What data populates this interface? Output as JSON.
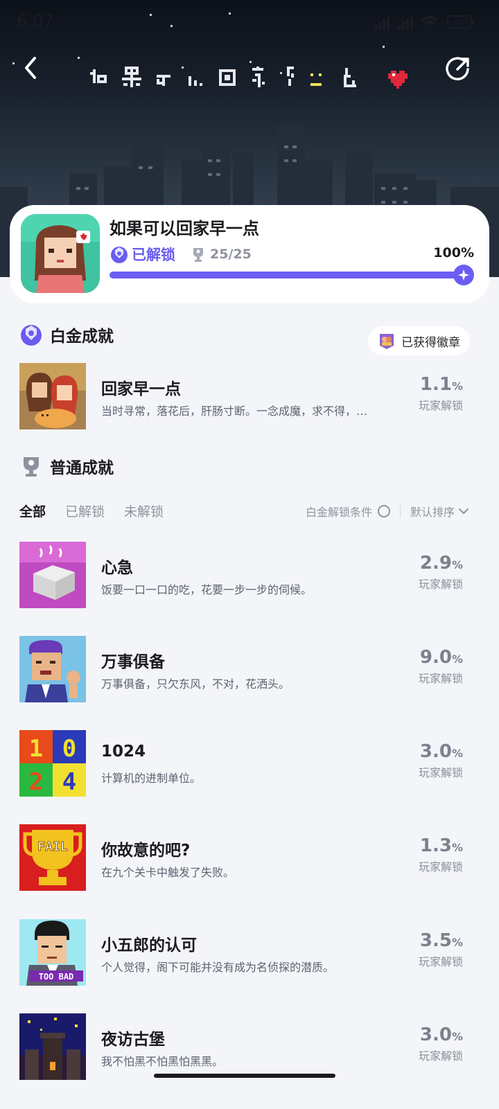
{
  "status_bar": {
    "time": "6:07",
    "battery": "54"
  },
  "game": {
    "title": "如果可以回家早一点",
    "unlock_label": "已解锁",
    "trophy_count": "25/25",
    "progress_percent": "100%",
    "progress_value": 1.0
  },
  "platinum": {
    "section_title": "白金成就",
    "badge_button": "已获得徽章",
    "item": {
      "name": "回家早一点",
      "desc": "当时寻常，落花后，肝肠寸断。一念成魔，求不得，…",
      "rate": "1.1",
      "unit": "%",
      "label": "玩家解锁"
    }
  },
  "normal": {
    "section_title": "普通成就",
    "tabs": [
      "全部",
      "已解锁",
      "未解锁"
    ],
    "filter_label": "白金解锁条件",
    "sort_label": "默认排序",
    "items": [
      {
        "name": "心急",
        "desc": "饭要一口一口的吃，花要一步一步的伺候。",
        "rate": "2.9",
        "unit": "%",
        "label": "玩家解锁"
      },
      {
        "name": "万事俱备",
        "desc": "万事俱备，只欠东风，不对，花洒头。",
        "rate": "9.0",
        "unit": "%",
        "label": "玩家解锁"
      },
      {
        "name": "1024",
        "desc": "计算机的进制单位。",
        "rate": "3.0",
        "unit": "%",
        "label": "玩家解锁"
      },
      {
        "name": "你故意的吧?",
        "desc": "在九个关卡中触发了失败。",
        "rate": "1.3",
        "unit": "%",
        "label": "玩家解锁"
      },
      {
        "name": "小五郎的认可",
        "desc": "个人觉得，阁下可能并没有成为名侦探的潜质。",
        "rate": "3.5",
        "unit": "%",
        "label": "玩家解锁"
      },
      {
        "name": "夜访古堡",
        "desc": "我不怕黑不怕黑怕黑黑。",
        "rate": "3.0",
        "unit": "%",
        "label": "玩家解锁"
      }
    ]
  },
  "thumb_texts": {
    "fail": "FAIL",
    "too_bad": "TOO BAD",
    "n1": "1",
    "n0": "0",
    "n2": "2",
    "n4": "4"
  },
  "icons": [
    "back-icon",
    "share-icon",
    "platinum-trophy-icon",
    "trophy-icon",
    "badge-icon",
    "chevron-down-icon",
    "radio-icon"
  ]
}
